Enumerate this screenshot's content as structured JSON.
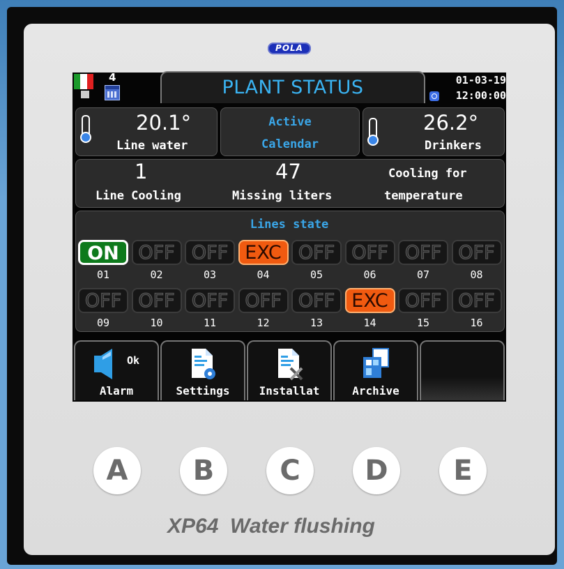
{
  "brand": "POLA",
  "header": {
    "title": "PLANT STATUS",
    "week_number": "4",
    "date": "01-03-19",
    "time": "12:00:00"
  },
  "line_water": {
    "value": "20.1°",
    "label": "Line water"
  },
  "calendar": {
    "line1": "Active",
    "line2": "Calendar"
  },
  "drinkers": {
    "value": "26.2°",
    "label": "Drinkers"
  },
  "info": {
    "line_cooling_value": "1",
    "line_cooling_label": "Line Cooling",
    "missing_value": "47",
    "missing_label": "Missing liters",
    "cooling_line1": "Cooling for",
    "cooling_line2": "temperature"
  },
  "lines_state_title": "Lines state",
  "lines": [
    {
      "num": "01",
      "state": "ON"
    },
    {
      "num": "02",
      "state": "OFF"
    },
    {
      "num": "03",
      "state": "OFF"
    },
    {
      "num": "04",
      "state": "EXC"
    },
    {
      "num": "05",
      "state": "OFF"
    },
    {
      "num": "06",
      "state": "OFF"
    },
    {
      "num": "07",
      "state": "OFF"
    },
    {
      "num": "08",
      "state": "OFF"
    },
    {
      "num": "09",
      "state": "OFF"
    },
    {
      "num": "10",
      "state": "OFF"
    },
    {
      "num": "11",
      "state": "OFF"
    },
    {
      "num": "12",
      "state": "OFF"
    },
    {
      "num": "13",
      "state": "OFF"
    },
    {
      "num": "14",
      "state": "EXC"
    },
    {
      "num": "15",
      "state": "OFF"
    },
    {
      "num": "16",
      "state": "OFF"
    }
  ],
  "tabs": {
    "alarm": "Alarm",
    "alarm_status": "Ok",
    "settings": "Settings",
    "installat": "Installat",
    "archive": "Archive"
  },
  "keys": [
    "A",
    "B",
    "C",
    "D",
    "E"
  ],
  "model": "XP64  Water flushing",
  "colors": {
    "accent_blue": "#3aa6e8",
    "on_green": "#0e7a1c",
    "exc_orange": "#f05a10"
  }
}
